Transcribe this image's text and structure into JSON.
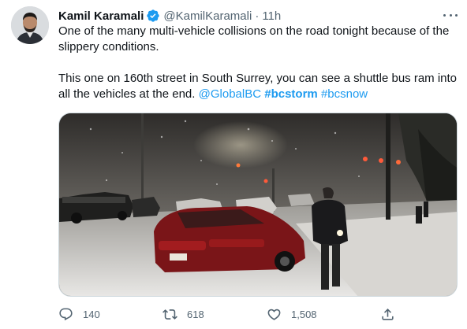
{
  "tweet": {
    "author": {
      "name": "Kamil Karamali",
      "handle": "@KamilKaramali",
      "separator": "·",
      "time": "11h",
      "verified": true
    },
    "text": {
      "paragraph1": "One of the many multi-vehicle collisions on the road tonight because of the slippery conditions.",
      "paragraph2_prefix": "This one on 160th street in South Surrey, you can see a shuttle bus ram into all the vehicles at the end. ",
      "mention": "@GlobalBC",
      "hashtag1": "#bcstorm",
      "hashtag2": "#bcsnow"
    },
    "media": {
      "description_icon": "video-thumbnail"
    },
    "actions": {
      "replies": "140",
      "retweets": "618",
      "likes": "1,508"
    }
  },
  "colors": {
    "accent": "#1d9bf0",
    "text_primary": "#0f1419",
    "text_secondary": "#536471",
    "border": "#cfd9de"
  },
  "icons": [
    "verified-badge-icon",
    "more-icon",
    "reply-icon",
    "retweet-icon",
    "like-icon",
    "share-icon"
  ]
}
